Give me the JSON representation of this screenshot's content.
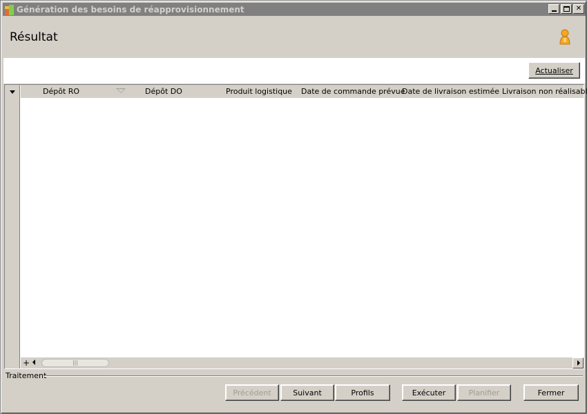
{
  "window": {
    "title": "Génération des besoins de réapprovisionnement"
  },
  "header": {
    "title": "Résultat"
  },
  "toolbar": {
    "refresh_label": "Actualiser"
  },
  "grid": {
    "columns": [
      "Dépôt RO",
      "Dépôt DO",
      "Produit logistique",
      "Date de commande prévue",
      "Date de livraison estimée",
      "Livraison non réalisable"
    ],
    "add_label": "+",
    "scroll_thumb_label": "|||"
  },
  "footer": {
    "section_label": "Traitement",
    "buttons": {
      "previous": "Précédent",
      "next": "Suivant",
      "profiles": "Profils",
      "execute": "Exécuter",
      "schedule": "Planifier",
      "close": "Fermer"
    }
  }
}
